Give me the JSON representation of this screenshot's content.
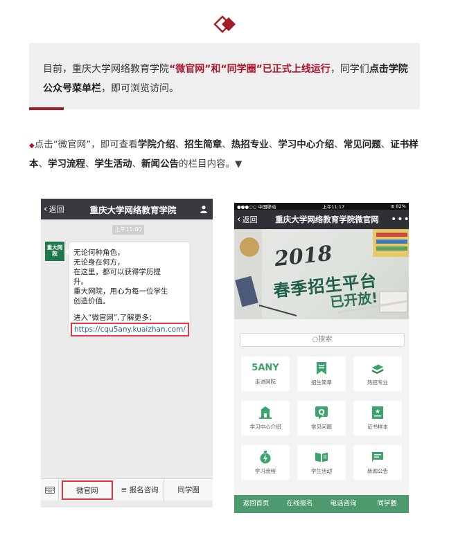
{
  "colors": {
    "accent_red": "#a8162c",
    "highlight_border": "#e0363f",
    "wechat_bar": "#393a3f",
    "site_green": "#4e9a6f",
    "intro_bg": "#efefef"
  },
  "intro": {
    "part1": "目前，重庆大学网络教育学院",
    "part2_highlight": "“微官网”和“同学圈”已正式上线运行",
    "part3": "，同学们",
    "part4_bold": "点击学院公众号菜单栏",
    "part5": "，即可浏览访问。"
  },
  "description": {
    "bullet": "◆",
    "lead": "点击“微官网”，即可查看",
    "items": [
      {
        "text": "学院介绍",
        "sep": "、"
      },
      {
        "text": "招生简章",
        "sep": "、"
      },
      {
        "text": "热招专业",
        "sep": "、"
      },
      {
        "text": "学习中心介绍",
        "sep": "、"
      },
      {
        "text": "常见问题",
        "sep": "、"
      },
      {
        "text": "证书样本",
        "sep": "、"
      },
      {
        "text": "学习流程",
        "sep": "、"
      },
      {
        "text": "学生活动",
        "sep": "、"
      },
      {
        "text": "新闻公告",
        "sep": ""
      }
    ],
    "tail": "的栏目内容。▼"
  },
  "chat": {
    "back_label": "返回",
    "title": "重庆大学网络教育学院",
    "time": "上午11:00",
    "avatar_text": "重大网院",
    "message_lines": [
      "无论何种角色，",
      "无论身在何方，",
      "在这里，都可以获得学历提",
      "升。",
      "重大网院，用心为每一位学生",
      "创造价值。"
    ],
    "more_line": "进入“微官网”,了解更多：",
    "link": "https://cqu5any.kuaizhan.com/",
    "menu": [
      "微官网",
      "≡ 报名咨询",
      "同学圈"
    ],
    "person_icon": "person-icon",
    "keyboard_icon": "keyboard-icon"
  },
  "site": {
    "status_left": "●●●○○ 中国移动  ",
    "status_time": "上午11:17",
    "status_right": "⊕  82%",
    "back_label": "返回",
    "title": "重庆大学网络教育学院微官网",
    "more": "•••",
    "banner_year": "2018",
    "banner_line1": "春季招生平台",
    "banner_line2": "已开放!",
    "search_placeholder": "搜索",
    "logo_text": "5ANY",
    "tiles": [
      {
        "label": "走进网院",
        "icon": "5any-logo"
      },
      {
        "label": "招生简章",
        "icon": "bookmark-icon"
      },
      {
        "label": "热招专业",
        "icon": "books-icon"
      },
      {
        "label": "学习中心介绍",
        "icon": "school-icon"
      },
      {
        "label": "常见问题",
        "icon": "question-icon"
      },
      {
        "label": "证书样本",
        "icon": "certificate-icon"
      },
      {
        "label": "学习流程",
        "icon": "lightning-icon"
      },
      {
        "label": "学生活动",
        "icon": "open-book-icon"
      },
      {
        "label": "新闻公告",
        "icon": "flag-icon"
      }
    ],
    "footer": [
      "返回首页",
      "在线报名",
      "电话咨询",
      "同学圈"
    ]
  }
}
